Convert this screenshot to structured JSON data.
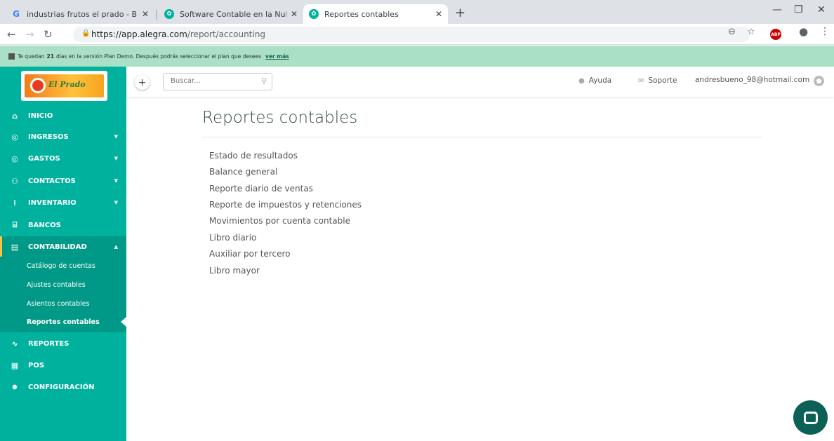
{
  "browser": {
    "tabs": [
      {
        "title": "industrias frutos el prado - Busca",
        "favicon": "google-g-icon",
        "active": false
      },
      {
        "title": "Software Contable en la Nube pa",
        "favicon": "alegra-icon",
        "active": false
      },
      {
        "title": "Reportes contables",
        "favicon": "alegra-icon",
        "active": true
      }
    ],
    "url_host": "https://app.alegra.com",
    "url_path": "/report/accounting",
    "abp_label": "ABP"
  },
  "banner": {
    "text_before": "Te quedan",
    "days": "21",
    "text_after": "días en la versión Plan Demo. Después podrás seleccionar el plan que desees",
    "link": "ver más"
  },
  "header": {
    "search_placeholder": "Buscar...",
    "help": "Ayuda",
    "support": "Soporte",
    "user_email": "andresbueno_98@hotmail.com"
  },
  "sidebar": {
    "items": [
      {
        "label": "INICIO",
        "icon": "home-icon"
      },
      {
        "label": "INGRESOS",
        "icon": "income-icon"
      },
      {
        "label": "GASTOS",
        "icon": "expenses-icon"
      },
      {
        "label": "CONTACTOS",
        "icon": "contacts-icon"
      },
      {
        "label": "INVENTARIO",
        "icon": "inventory-icon"
      },
      {
        "label": "BANCOS",
        "icon": "bank-icon"
      },
      {
        "label": "CONTABILIDAD",
        "icon": "accounting-icon"
      },
      {
        "label": "REPORTES",
        "icon": "reports-icon"
      },
      {
        "label": "POS",
        "icon": "pos-icon"
      },
      {
        "label": "CONFIGURACIÓN",
        "icon": "gear-icon"
      }
    ],
    "submenu": [
      "Catálogo de cuentas",
      "Ajustes contables",
      "Asientos contables",
      "Reportes contables"
    ]
  },
  "main": {
    "title": "Reportes contables",
    "reports": [
      "Estado de resultados",
      "Balance general",
      "Reporte diario de ventas",
      "Reporte de impuestos y retenciones",
      "Movimientos por cuenta contable",
      "Libro diario",
      "Auxiliar por tercero",
      "Libro mayor"
    ]
  },
  "colors": {
    "sidebar": "#00b19d",
    "sidebar_active": "#009987",
    "banner": "#a9e0c6",
    "chat": "#0b6156"
  }
}
